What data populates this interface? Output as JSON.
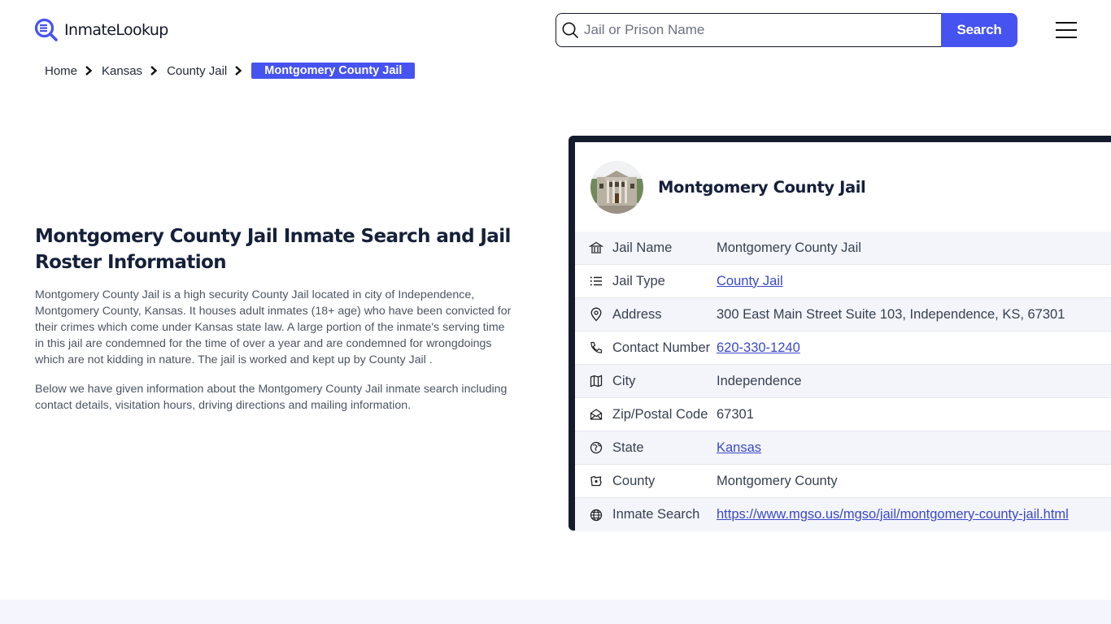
{
  "header": {
    "logo_text": "InmateLookup",
    "search_placeholder": "Jail or Prison Name",
    "search_value": "",
    "search_button": "Search",
    "brand_color": "#4653f0"
  },
  "breadcrumb": {
    "items": [
      "Home",
      "Kansas",
      "County Jail"
    ],
    "current": "Montgomery County Jail"
  },
  "intro": {
    "title": "Montgomery County Jail Inmate Search and Jail Roster Information",
    "paragraphs": [
      "Montgomery County Jail is a high security County Jail located in city of Independence, Montgomery County, Kansas. It houses adult inmates (18+ age) who have been convicted for their crimes which come under Kansas state law. A large portion of the inmate's serving time in this jail are condemned for the time of over a year and are condemned for wrongdoings which are not kidding in nature. The jail is worked and kept up by County Jail .",
      "Below we have given information about the Montgomery County Jail inmate search including contact details, visitation hours, driving directions and mailing information."
    ]
  },
  "card": {
    "title": "Montgomery County Jail",
    "rows": [
      {
        "icon": "bank-icon",
        "label": "Jail Name",
        "value": "Montgomery County Jail",
        "link": false
      },
      {
        "icon": "list-icon",
        "label": "Jail Type",
        "value": "County Jail",
        "link": true
      },
      {
        "icon": "map-pin-icon",
        "label": "Address",
        "value": "300 East Main Street Suite 103, Independence, KS, 67301",
        "link": false
      },
      {
        "icon": "phone-icon",
        "label": "Contact Number",
        "value": "620-330-1240",
        "link": true
      },
      {
        "icon": "map-icon",
        "label": "City",
        "value": "Independence",
        "link": false
      },
      {
        "icon": "mail-open-icon",
        "label": "Zip/Postal Code",
        "value": "67301",
        "link": false
      },
      {
        "icon": "globe-state-icon",
        "label": "State",
        "value": "Kansas",
        "link": true
      },
      {
        "icon": "county-icon",
        "label": "County",
        "value": "Montgomery County",
        "link": false
      },
      {
        "icon": "globe-icon",
        "label": "Inmate Search",
        "value": "https://www.mgso.us/mgso/jail/montgomery-county-jail.html",
        "link": true
      }
    ]
  }
}
